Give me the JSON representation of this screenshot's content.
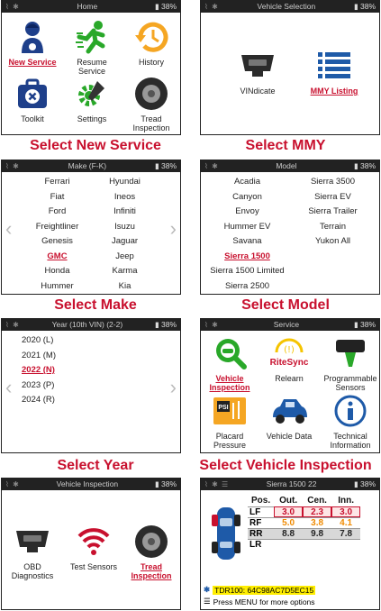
{
  "battery": "38%",
  "panels": {
    "home": {
      "title": "Home",
      "tiles": [
        {
          "label": "New Service",
          "selected": true,
          "icon": "mechanic-icon"
        },
        {
          "label": "Resume Service",
          "selected": false,
          "icon": "running-man-icon"
        },
        {
          "label": "History",
          "selected": false,
          "icon": "history-clock-icon"
        },
        {
          "label": "Toolkit",
          "selected": false,
          "icon": "toolkit-icon"
        },
        {
          "label": "Settings",
          "selected": false,
          "icon": "settings-gear-icon"
        },
        {
          "label": "Tread Inspection",
          "selected": false,
          "icon": "tire-icon"
        }
      ],
      "caption": "Select New Service"
    },
    "vehicle_selection": {
      "title": "Vehicle Selection",
      "tiles": [
        {
          "label": "VINdicate",
          "selected": false,
          "icon": "obd-port-icon"
        },
        {
          "label": "MMY Listing",
          "selected": true,
          "icon": "list-icon"
        }
      ],
      "caption": "Select MMY"
    },
    "make": {
      "title": "Make (F-K)",
      "items": [
        "Ferrari",
        "Hyundai",
        "Fiat",
        "Ineos",
        "Ford",
        "Infiniti",
        "Freightliner",
        "Isuzu",
        "Genesis",
        "Jaguar",
        "GMC",
        "Jeep",
        "Honda",
        "Karma",
        "Hummer",
        "Kia"
      ],
      "selected": "GMC",
      "caption": "Select Make"
    },
    "model": {
      "title": "Model",
      "items": [
        "Acadia",
        "Sierra 3500",
        "Canyon",
        "Sierra EV",
        "Envoy",
        "Sierra Trailer",
        "Hummer EV",
        "Terrain",
        "Savana",
        "Yukon All",
        "Sierra 1500",
        "",
        "Sierra 1500 Limited",
        "",
        "Sierra 2500",
        ""
      ],
      "selected": "Sierra 1500",
      "caption": "Select Model"
    },
    "year": {
      "title": "Year (10th VIN) (2-2)",
      "items": [
        "2020 (L)",
        "2021 (M)",
        "2022 (N)",
        "2023 (P)",
        "2024 (R)"
      ],
      "selected": "2022 (N)",
      "caption": "Select Year"
    },
    "service": {
      "title": "Service",
      "tiles": [
        {
          "label": "Vehicle Inspection",
          "selected": true,
          "icon": "magnifier-car-icon"
        },
        {
          "label": "Relearn",
          "selected": false,
          "icon": "ritesync-icon"
        },
        {
          "label": "Programmable Sensors",
          "selected": false,
          "icon": "sensor-icon"
        },
        {
          "label": "Placard Pressure",
          "selected": false,
          "icon": "psi-placard-icon"
        },
        {
          "label": "Vehicle Data",
          "selected": false,
          "icon": "car-icon"
        },
        {
          "label": "Technical Information",
          "selected": false,
          "icon": "info-icon"
        }
      ],
      "ritesync_text": "RiteSync",
      "psi_text": "PSI",
      "caption": "Select Vehicle Inspection"
    },
    "inspection": {
      "title": "Vehicle Inspection",
      "tiles": [
        {
          "label": "OBD Diagnostics",
          "selected": false,
          "icon": "obd-port-icon"
        },
        {
          "label": "Test Sensors",
          "selected": false,
          "icon": "wireless-icon"
        },
        {
          "label": "Tread Inspection",
          "selected": true,
          "icon": "tire-icon"
        }
      ]
    },
    "tpms": {
      "title": "Sierra 1500 22",
      "headers": [
        "Pos.",
        "Out.",
        "Cen.",
        "Inn."
      ],
      "rows": [
        {
          "pos": "LF",
          "out": "3.0",
          "cen": "2.3",
          "inn": "3.0",
          "color": "red",
          "highlight": false,
          "boxed": true
        },
        {
          "pos": "RF",
          "out": "5.0",
          "cen": "3.8",
          "inn": "4.1",
          "color": "orange",
          "highlight": false,
          "boxed": false
        },
        {
          "pos": "RR",
          "out": "8.8",
          "cen": "9.8",
          "inn": "7.8",
          "color": "black",
          "highlight": true,
          "boxed": false
        },
        {
          "pos": "LR",
          "out": "",
          "cen": "",
          "inn": "",
          "color": "black",
          "highlight": false,
          "boxed": false
        }
      ],
      "tdr": "TDR100: 64C98AC7D5EC15",
      "hint": "Press MENU for more options"
    }
  }
}
